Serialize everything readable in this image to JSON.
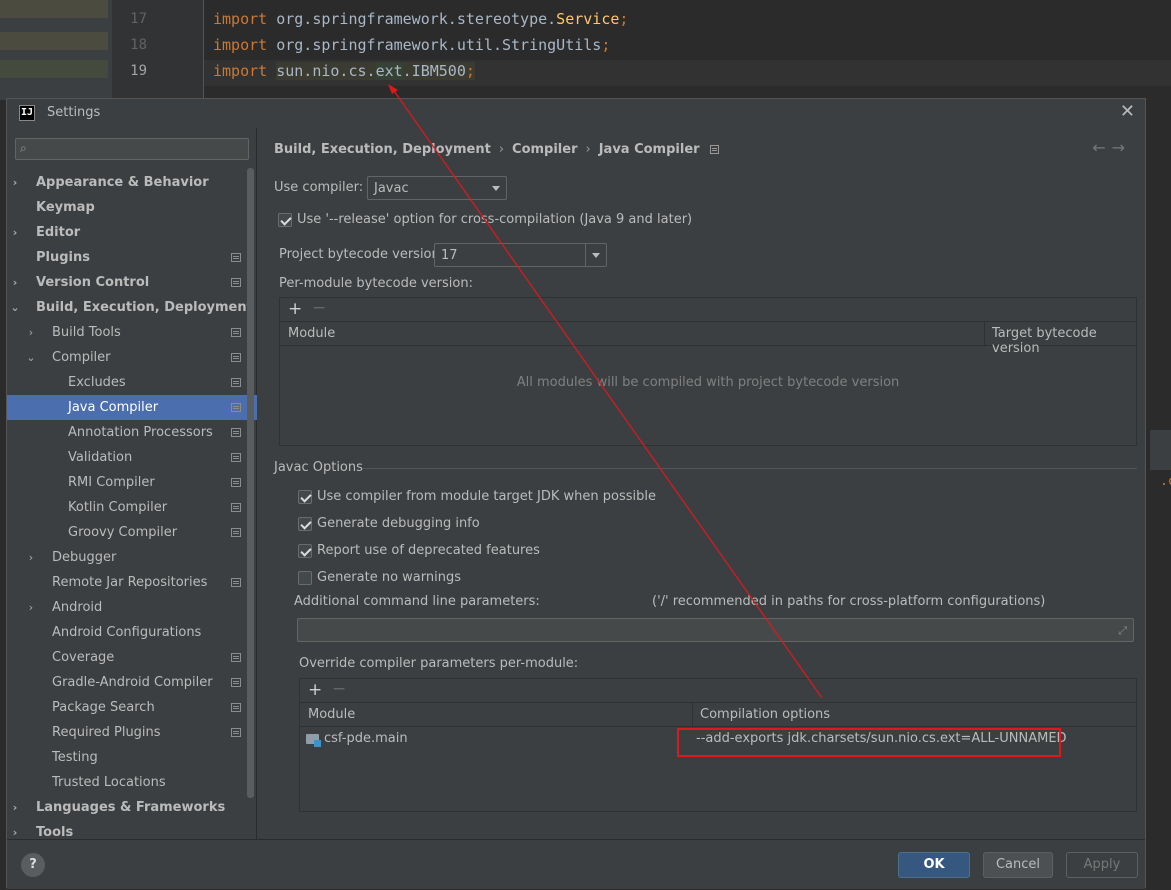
{
  "editor": {
    "line_numbers": [
      "17",
      "18",
      "19"
    ],
    "lines": [
      {
        "kw": "import",
        "text": " org.springframework.stereotype.",
        "cls": "Service",
        "tail": ";"
      },
      {
        "kw": "import",
        "text": " org.springframework.util.StringUtils",
        "cls": "",
        "tail": ";"
      },
      {
        "kw": "import",
        "pkg1": "sun.nio.cs.",
        "pkg2": "ext",
        "pkg3": ".IBM500",
        "tail": ";"
      }
    ],
    "right_fragment": ".c"
  },
  "dialog": {
    "title": "Settings",
    "app_icon": "IJ",
    "close_icon": "close-icon",
    "search_placeholder": ""
  },
  "tree": [
    {
      "label": "Appearance & Behavior",
      "level": 0,
      "arrow": "right",
      "bold": true,
      "proj": false
    },
    {
      "label": "Keymap",
      "level": 0,
      "arrow": "",
      "bold": true,
      "proj": false
    },
    {
      "label": "Editor",
      "level": 0,
      "arrow": "right",
      "bold": true,
      "proj": false
    },
    {
      "label": "Plugins",
      "level": 0,
      "arrow": "",
      "bold": true,
      "proj": true
    },
    {
      "label": "Version Control",
      "level": 0,
      "arrow": "right",
      "bold": true,
      "proj": true
    },
    {
      "label": "Build, Execution, Deployment",
      "level": 0,
      "arrow": "down",
      "bold": true,
      "proj": false
    },
    {
      "label": "Build Tools",
      "level": 1,
      "arrow": "right",
      "bold": false,
      "proj": true
    },
    {
      "label": "Compiler",
      "level": 1,
      "arrow": "down",
      "bold": false,
      "proj": true
    },
    {
      "label": "Excludes",
      "level": 2,
      "arrow": "",
      "bold": false,
      "proj": true
    },
    {
      "label": "Java Compiler",
      "level": 2,
      "arrow": "",
      "bold": false,
      "proj": true,
      "selected": true
    },
    {
      "label": "Annotation Processors",
      "level": 2,
      "arrow": "",
      "bold": false,
      "proj": true
    },
    {
      "label": "Validation",
      "level": 2,
      "arrow": "",
      "bold": false,
      "proj": true
    },
    {
      "label": "RMI Compiler",
      "level": 2,
      "arrow": "",
      "bold": false,
      "proj": true
    },
    {
      "label": "Kotlin Compiler",
      "level": 2,
      "arrow": "",
      "bold": false,
      "proj": true
    },
    {
      "label": "Groovy Compiler",
      "level": 2,
      "arrow": "",
      "bold": false,
      "proj": true
    },
    {
      "label": "Debugger",
      "level": 1,
      "arrow": "right",
      "bold": false,
      "proj": false
    },
    {
      "label": "Remote Jar Repositories",
      "level": 1,
      "arrow": "",
      "bold": false,
      "proj": true
    },
    {
      "label": "Android",
      "level": 1,
      "arrow": "right",
      "bold": false,
      "proj": false
    },
    {
      "label": "Android Configurations",
      "level": 1,
      "arrow": "",
      "bold": false,
      "proj": false
    },
    {
      "label": "Coverage",
      "level": 1,
      "arrow": "",
      "bold": false,
      "proj": true
    },
    {
      "label": "Gradle-Android Compiler",
      "level": 1,
      "arrow": "",
      "bold": false,
      "proj": true
    },
    {
      "label": "Package Search",
      "level": 1,
      "arrow": "",
      "bold": false,
      "proj": true
    },
    {
      "label": "Required Plugins",
      "level": 1,
      "arrow": "",
      "bold": false,
      "proj": true
    },
    {
      "label": "Testing",
      "level": 1,
      "arrow": "",
      "bold": false,
      "proj": false
    },
    {
      "label": "Trusted Locations",
      "level": 1,
      "arrow": "",
      "bold": false,
      "proj": false
    },
    {
      "label": "Languages & Frameworks",
      "level": 0,
      "arrow": "right",
      "bold": true,
      "proj": false
    },
    {
      "label": "Tools",
      "level": 0,
      "arrow": "right",
      "bold": true,
      "proj": false
    }
  ],
  "breadcrumb": {
    "part1": "Build, Execution, Deployment",
    "sep": "›",
    "part2": "Compiler",
    "part3": "Java Compiler",
    "back": "←",
    "forward": "→"
  },
  "compiler": {
    "use_compiler_label": "Use compiler:",
    "use_compiler_value": "Javac",
    "release_option_label": "Use '--release' option for cross-compilation (Java 9 and later)",
    "release_option_checked": true,
    "bytecode_label": "Project bytecode version:",
    "bytecode_value": "17",
    "per_module_label": "Per-module bytecode version:",
    "per_module_table": {
      "add": "+",
      "remove": "−",
      "col_module": "Module",
      "col_target": "Target bytecode version",
      "empty_text": "All modules will be compiled with project bytecode version"
    }
  },
  "javac_options": {
    "section_title": "Javac Options",
    "options": [
      {
        "label": "Use compiler from module target JDK when possible",
        "checked": true
      },
      {
        "label": "Generate debugging info",
        "checked": true
      },
      {
        "label": "Report use of deprecated features",
        "checked": true
      },
      {
        "label": "Generate no warnings",
        "checked": false
      }
    ],
    "additional_params_label": "Additional command line parameters:",
    "additional_params_hint": "('/' recommended in paths for cross-platform configurations)",
    "additional_params_value": "",
    "override_label": "Override compiler parameters per-module:",
    "override_table": {
      "add": "+",
      "remove": "−",
      "col_module": "Module",
      "col_options": "Compilation options",
      "rows": [
        {
          "module": "csf-pde.main",
          "options": "--add-exports jdk.charsets/sun.nio.cs.ext=ALL-UNNAMED"
        }
      ]
    }
  },
  "footer": {
    "help": "?",
    "ok": "OK",
    "cancel": "Cancel",
    "apply": "Apply"
  },
  "colors": {
    "selection": "#4b6eaf",
    "annotation_red": "#e0181c",
    "primary_button": "#365880"
  }
}
